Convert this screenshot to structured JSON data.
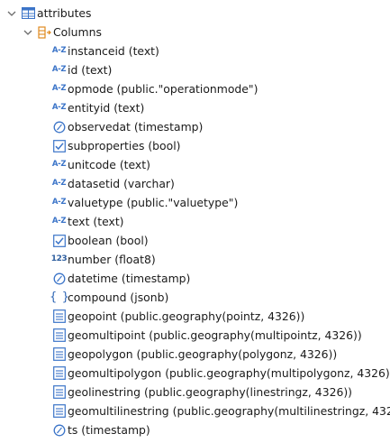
{
  "tree": {
    "table": {
      "label": "attributes"
    },
    "folder": {
      "label": "Columns"
    },
    "columns": [
      {
        "label": "instanceid (text)",
        "icon": "text-type-icon",
        "glyph": "A-Z"
      },
      {
        "label": "id (text)",
        "icon": "text-type-icon",
        "glyph": "A-Z"
      },
      {
        "label": "opmode (public.\"operationmode\")",
        "icon": "text-type-icon",
        "glyph": "A-Z"
      },
      {
        "label": "entityid (text)",
        "icon": "text-type-icon",
        "glyph": "A-Z"
      },
      {
        "label": "observedat (timestamp)",
        "icon": "clock-icon",
        "glyph": ""
      },
      {
        "label": "subproperties (bool)",
        "icon": "checkbox-icon",
        "glyph": ""
      },
      {
        "label": "unitcode (text)",
        "icon": "text-type-icon",
        "glyph": "A-Z"
      },
      {
        "label": "datasetid (varchar)",
        "icon": "text-type-icon",
        "glyph": "A-Z"
      },
      {
        "label": "valuetype (public.\"valuetype\")",
        "icon": "text-type-icon",
        "glyph": "A-Z"
      },
      {
        "label": "text (text)",
        "icon": "text-type-icon",
        "glyph": "A-Z"
      },
      {
        "label": "boolean (bool)",
        "icon": "checkbox-icon",
        "glyph": ""
      },
      {
        "label": "number (float8)",
        "icon": "numeric-type-icon",
        "glyph": "123"
      },
      {
        "label": "datetime (timestamp)",
        "icon": "clock-icon",
        "glyph": ""
      },
      {
        "label": "compound (jsonb)",
        "icon": "json-braces-icon",
        "glyph": "{ }"
      },
      {
        "label": "geopoint (public.geography(pointz, 4326))",
        "icon": "geometry-doc-icon",
        "glyph": ""
      },
      {
        "label": "geomultipoint (public.geography(multipointz, 4326))",
        "icon": "geometry-doc-icon",
        "glyph": ""
      },
      {
        "label": "geopolygon (public.geography(polygonz, 4326))",
        "icon": "geometry-doc-icon",
        "glyph": ""
      },
      {
        "label": "geomultipolygon (public.geography(multipolygonz, 4326))",
        "icon": "geometry-doc-icon",
        "glyph": ""
      },
      {
        "label": "geolinestring (public.geography(linestringz, 4326))",
        "icon": "geometry-doc-icon",
        "glyph": ""
      },
      {
        "label": "geomultilinestring (public.geography(multilinestringz, 4326))",
        "icon": "geometry-doc-icon",
        "glyph": ""
      },
      {
        "label": "ts (timestamp)",
        "icon": "clock-icon",
        "glyph": ""
      }
    ]
  },
  "colors": {
    "icon_blue": "#3b74c8",
    "folder_orange": "#e08a1e",
    "caret_gray": "#6b6b6b"
  }
}
